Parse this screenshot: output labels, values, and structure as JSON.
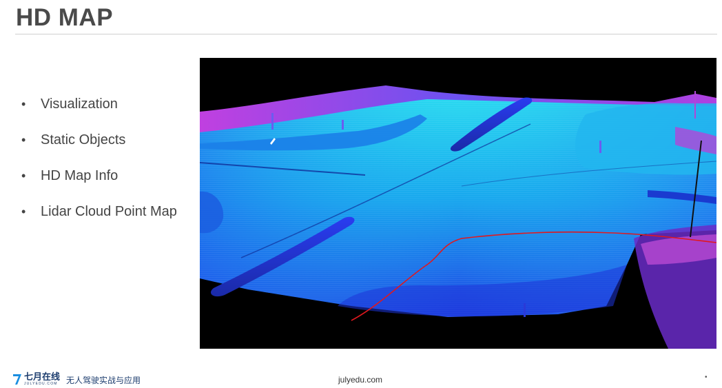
{
  "slide": {
    "title": "HD MAP"
  },
  "bullets": [
    {
      "text": "Visualization"
    },
    {
      "text": "Static Objects"
    },
    {
      "text": "HD Map Info"
    },
    {
      "text": "Lidar Cloud Point Map"
    }
  ],
  "bullet_symbol": "•",
  "map_image": {
    "colors": {
      "background": "#000000",
      "road_near": "#1e6cf0",
      "road_far": "#19d2f0",
      "edges": "#b040e0",
      "trajectory": "#e0181e"
    }
  },
  "footer": {
    "logo_name": "七月在线",
    "logo_url": "JULYEDU.COM",
    "course_name": "无人驾驶实战与应用",
    "site": "julyedu.com",
    "page_marker": "•",
    "brand_color": "#1d3d6e"
  }
}
